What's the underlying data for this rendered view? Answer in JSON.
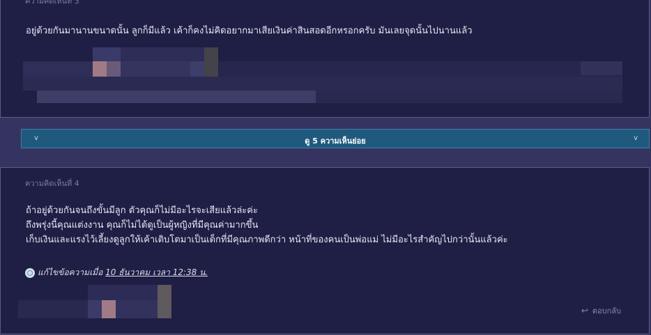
{
  "comment3": {
    "number_label": "ความคิดเห็นที่ 3",
    "text": "อยู่ด้วยกันมานานขนาดนั้น ลูกก็มีแล้ว เค้าก็คงไม่คิดอยากมาเสียเงินค่าสินสอดอีกหรอกครับ  มันเลยจุดนั้นไปนานแล้ว"
  },
  "sub_comments_toggle": {
    "label": "ดู 5 ความเห็นย่อย",
    "left_chevron": "v",
    "right_chevron": "v"
  },
  "comment4": {
    "number_label": "ความคิดเห็นที่ 4",
    "lines": [
      "ถ้าอยู่ด้วยกันจนถึงขั้นมีลูก ตัวคุณก็ไม่มีอะไรจะเสียแล้วล่ะค่ะ",
      "ถึงพรุ่งนี้คุณแต่งงาน คุณก็ไม่ได้ดูเป็นผู้หญิงที่มีคุณค่ามากขึ้น",
      "เก็บเงินและแรงไว้เลี้ยงดูลูกให้เค้าเติบโตมาเป็นเด็กที่มีคุณภาพดีกว่า หน้าที่ของคนเป็นพ่อแม่ ไม่มีอะไรสำคัญไปกว่านั้นแล้วค่ะ"
    ],
    "edited_prefix": "แก้ไขข้อความเมื่อ",
    "edited_date": "10 ธันวาคม เวลา 12:38 น.",
    "reply_label": "ตอบกลับ"
  },
  "colors": {
    "page_bg": "#353460",
    "comment_bg": "#1f1e45",
    "toggle_bg": "#1f5a7e"
  }
}
